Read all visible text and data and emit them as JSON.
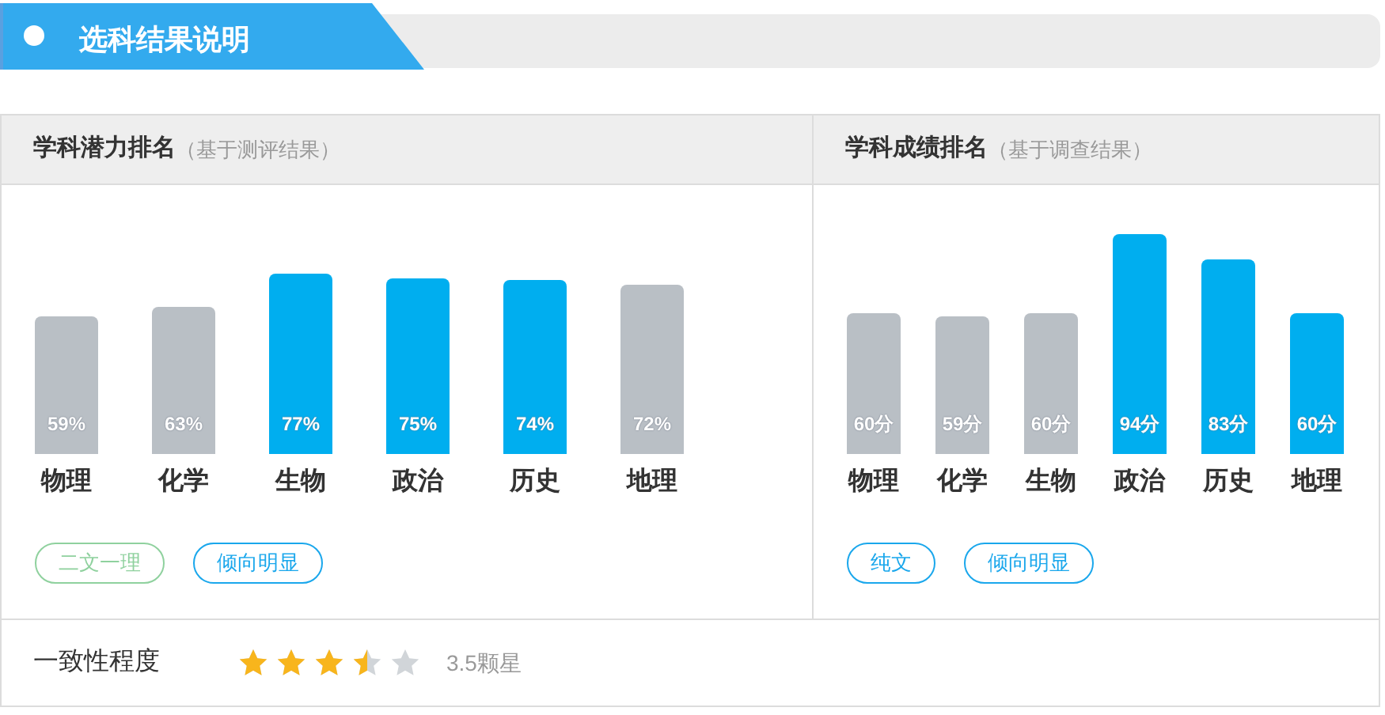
{
  "section_title": "选科结果说明",
  "panels": [
    {
      "title": "学科潜力排名",
      "subtitle": "（基于测评结果）",
      "chart_data": {
        "type": "bar",
        "categories": [
          "物理",
          "化学",
          "生物",
          "政治",
          "历史",
          "地理"
        ],
        "values": [
          59,
          63,
          77,
          75,
          74,
          72
        ],
        "value_labels": [
          "59%",
          "63%",
          "77%",
          "75%",
          "74%",
          "72%"
        ],
        "colors": [
          "#b9bfc5",
          "#b9bfc5",
          "#00aeef",
          "#00aeef",
          "#00aeef",
          "#b9bfc5"
        ],
        "data_labels": true
      },
      "tags": [
        {
          "label": "二文一理",
          "color": "#8fd19e"
        },
        {
          "label": "倾向明显",
          "color": "#1aa7ec"
        }
      ]
    },
    {
      "title": "学科成绩排名",
      "subtitle": "（基于调查结果）",
      "chart_data": {
        "type": "bar",
        "categories": [
          "物理",
          "化学",
          "生物",
          "政治",
          "历史",
          "地理"
        ],
        "values": [
          60,
          59,
          60,
          94,
          83,
          60
        ],
        "value_labels": [
          "60分",
          "59分",
          "60分",
          "94分",
          "83分",
          "60分"
        ],
        "colors": [
          "#b9bfc5",
          "#b9bfc5",
          "#b9bfc5",
          "#00aeef",
          "#00aeef",
          "#00aeef"
        ],
        "data_labels": true
      },
      "tags": [
        {
          "label": "纯文",
          "color": "#1aa7ec"
        },
        {
          "label": "倾向明显",
          "color": "#1aa7ec"
        }
      ]
    }
  ],
  "consistency": {
    "label": "一致性程度",
    "stars": 3.5,
    "reading": "3.5颗星"
  }
}
